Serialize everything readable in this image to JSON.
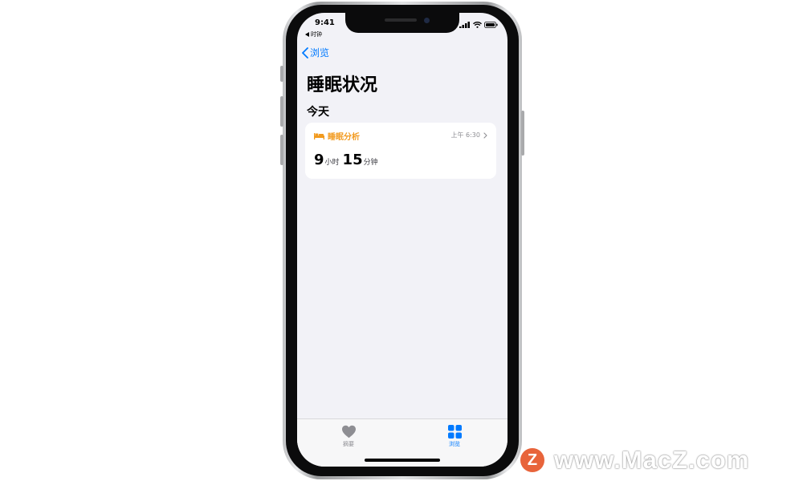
{
  "status_bar": {
    "time": "9:41",
    "back_app": "时钟"
  },
  "nav": {
    "back_label": "浏览"
  },
  "page": {
    "title": "睡眠状况",
    "section": "今天"
  },
  "card": {
    "title": "睡眠分析",
    "time": "上午 6:30",
    "hours": "9",
    "hours_unit": "小时",
    "minutes": "15",
    "minutes_unit": "分钟",
    "icon": "bed-icon"
  },
  "tabbar": {
    "items": [
      {
        "label": "摘要",
        "icon": "heart-icon",
        "active": false
      },
      {
        "label": "浏览",
        "icon": "grid-icon",
        "active": true
      }
    ]
  },
  "watermark": {
    "logo": "Z",
    "text": "www.MacZ.com"
  },
  "colors": {
    "accent": "#007aff",
    "sleep": "#f29a1e",
    "background": "#f2f2f7"
  }
}
